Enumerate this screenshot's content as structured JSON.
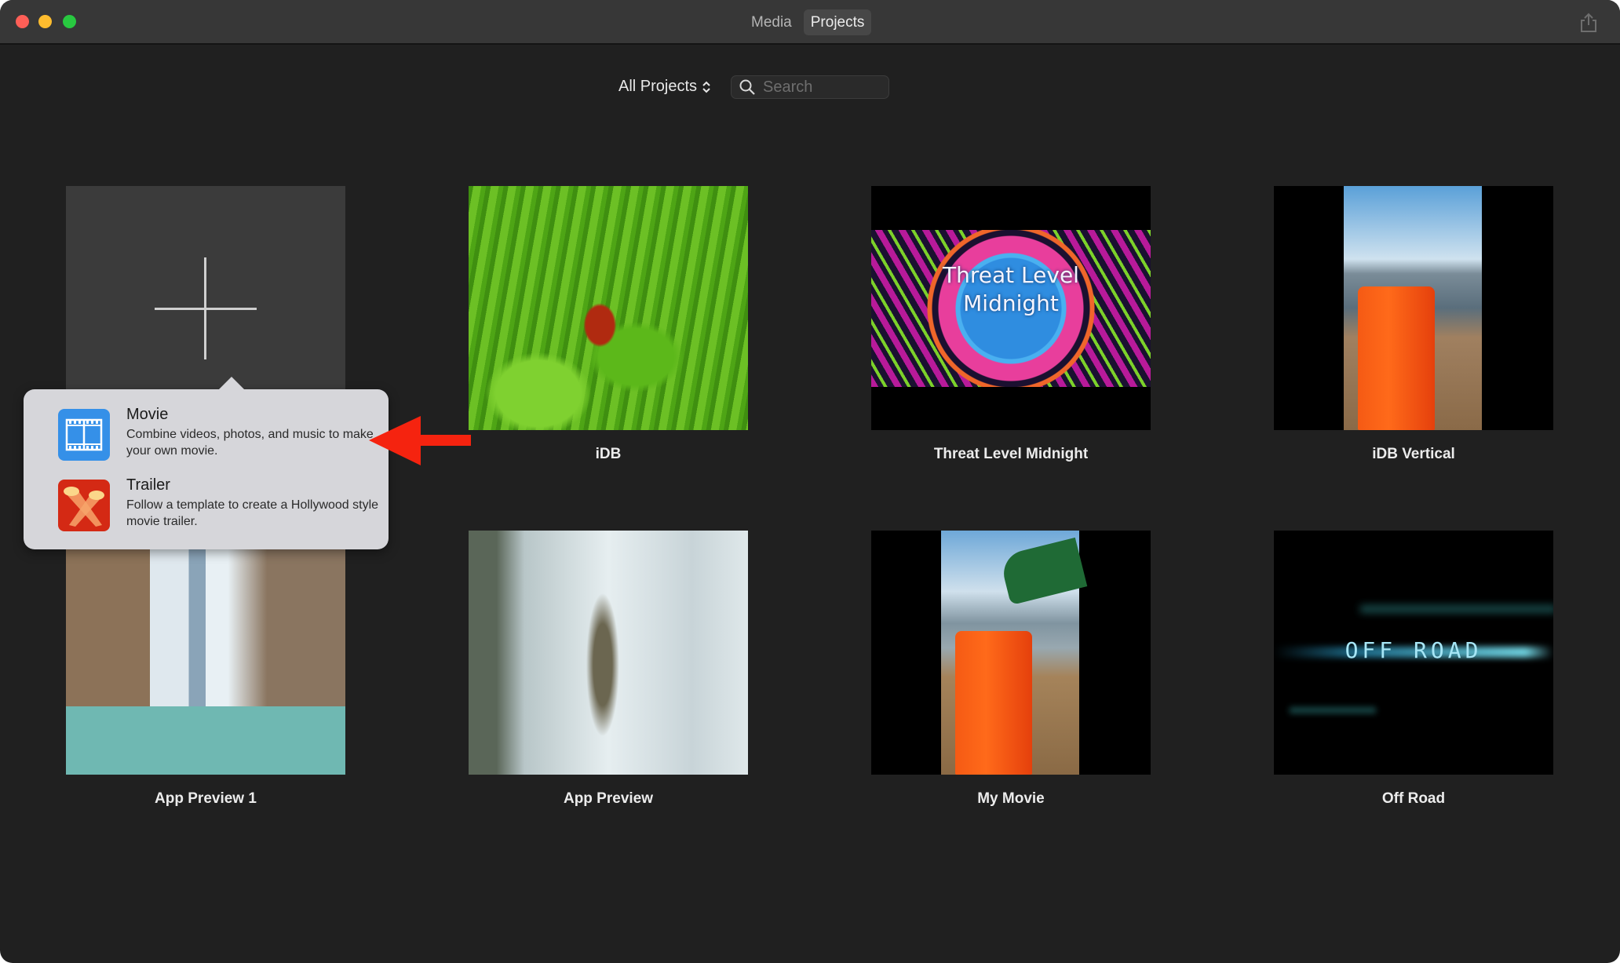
{
  "window": {
    "tabs": [
      {
        "label": "Media",
        "active": false
      },
      {
        "label": "Projects",
        "active": true
      }
    ],
    "share_icon": "share-icon"
  },
  "toolbar": {
    "filter_label": "All Projects",
    "filter_icon": "chevron-updown-icon",
    "search_placeholder": "Search",
    "search_value": ""
  },
  "new_project": {
    "icon": "plus-icon"
  },
  "projects": [
    {
      "title": "iDB"
    },
    {
      "title": "Threat Level Midnight",
      "thumbnail_text": "Threat Level Midnight"
    },
    {
      "title": "iDB Vertical"
    },
    {
      "title": "App Preview 1"
    },
    {
      "title": "App Preview"
    },
    {
      "title": "My Movie"
    },
    {
      "title": "Off Road",
      "thumbnail_text": "OFF ROAD"
    }
  ],
  "popover": {
    "items": [
      {
        "title": "Movie",
        "description": "Combine videos, photos, and music to make your own movie.",
        "icon": "film-strip-icon"
      },
      {
        "title": "Trailer",
        "description": "Follow a template to create a Hollywood style movie trailer.",
        "icon": "spotlights-icon"
      }
    ]
  },
  "annotation": {
    "icon": "red-arrow-icon",
    "color": "#f5230f"
  },
  "colors": {
    "window_bg": "#202020",
    "titlebar_bg": "#373737",
    "popover_bg": "#d6d6da",
    "movie_icon": "#3590e8",
    "trailer_icon": "#d42914"
  }
}
